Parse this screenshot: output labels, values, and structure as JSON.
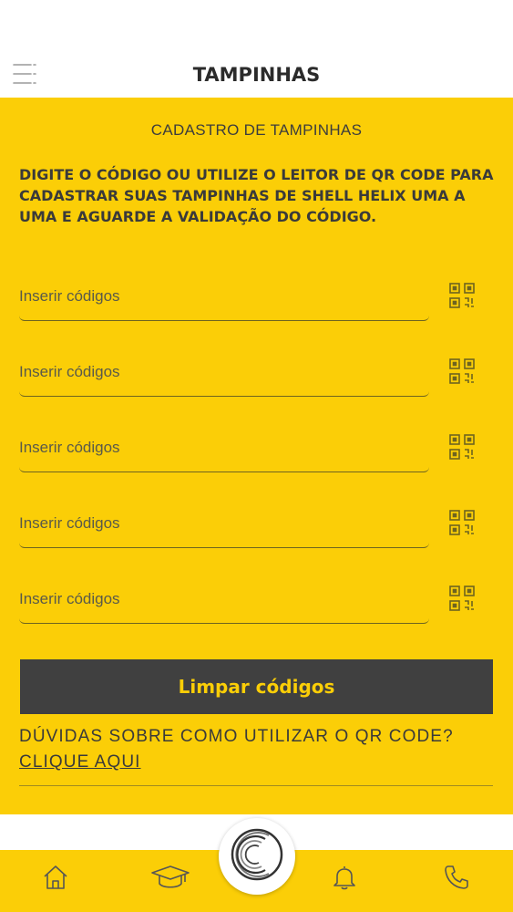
{
  "header": {
    "title": "TAMPINHAS",
    "menu_icon": "hamburger-menu-icon"
  },
  "main": {
    "subtitle": "CADASTRO DE TAMPINHAS",
    "instructions": "DIGITE O CÓDIGO OU UTILIZE O LEITOR DE QR CODE PARA CADASTRAR SUAS TAMPINHAS DE SHELL HELIX UMA A UMA E AGUARDE A VALIDAÇÃO DO CÓDIGO.",
    "code_fields": [
      {
        "placeholder": "Inserir códigos",
        "value": "",
        "icon": "qr-code-icon"
      },
      {
        "placeholder": "Inserir códigos",
        "value": "",
        "icon": "qr-code-icon"
      },
      {
        "placeholder": "Inserir códigos",
        "value": "",
        "icon": "qr-code-icon"
      },
      {
        "placeholder": "Inserir códigos",
        "value": "",
        "icon": "qr-code-icon"
      },
      {
        "placeholder": "Inserir códigos",
        "value": "",
        "icon": "qr-code-icon"
      }
    ],
    "clear_button": "Limpar códigos",
    "faq_question": "DÚVIDAS SOBRE COMO UTILIZAR O QR CODE?",
    "faq_link": "CLIQUE AQUI"
  },
  "tabbar": {
    "tabs": [
      {
        "icon": "home-icon"
      },
      {
        "icon": "graduation-cap-icon"
      },
      {
        "icon": "shell-helix-logo-icon"
      },
      {
        "icon": "bell-icon"
      },
      {
        "icon": "phone-icon"
      }
    ]
  },
  "colors": {
    "accent_yellow": "#fbce07",
    "dark_button": "#404040",
    "text_dark": "#3a3a3a"
  }
}
